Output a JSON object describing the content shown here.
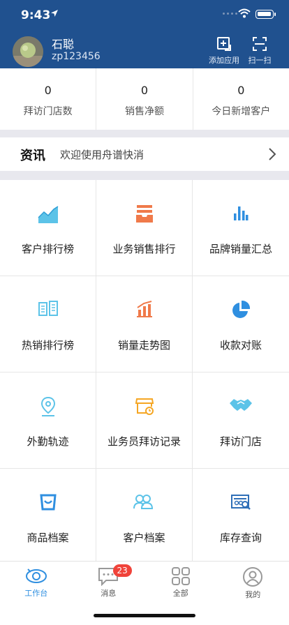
{
  "status": {
    "time": "9:43"
  },
  "user": {
    "name": "石聪",
    "id": "zp123456"
  },
  "header_actions": {
    "add_app": "添加应用",
    "scan": "扫一扫"
  },
  "stats": [
    {
      "value": "0",
      "label": "拜访门店数"
    },
    {
      "value": "0",
      "label": "销售净额"
    },
    {
      "value": "0",
      "label": "今日新增客户"
    }
  ],
  "news": {
    "title": "资讯",
    "text": "欢迎使用舟谱快消"
  },
  "grid": [
    {
      "label": "客户排行榜",
      "icon": "area-chart-icon"
    },
    {
      "label": "业务销售排行",
      "icon": "inbox-list-icon"
    },
    {
      "label": "品牌销量汇总",
      "icon": "bar-chart-icon"
    },
    {
      "label": "热销排行榜",
      "icon": "book-icon"
    },
    {
      "label": "销量走势图",
      "icon": "trend-bar-icon"
    },
    {
      "label": "收款对账",
      "icon": "pie-chart-icon"
    },
    {
      "label": "外勤轨迹",
      "icon": "location-pin-icon"
    },
    {
      "label": "业务员拜访记录",
      "icon": "store-clock-icon"
    },
    {
      "label": "拜访门店",
      "icon": "handshake-icon"
    },
    {
      "label": "商品档案",
      "icon": "bag-icon"
    },
    {
      "label": "客户档案",
      "icon": "people-icon"
    },
    {
      "label": "库存查询",
      "icon": "search-doc-icon"
    }
  ],
  "tabs": [
    {
      "label": "工作台",
      "icon": "workbench-icon",
      "active": true
    },
    {
      "label": "消息",
      "icon": "message-icon",
      "badge": "23"
    },
    {
      "label": "全部",
      "icon": "grid-icon"
    },
    {
      "label": "我的",
      "icon": "person-icon"
    }
  ],
  "colors": {
    "header": "#20518f",
    "accent": "#2f8fe0",
    "badge": "#f0433a",
    "orange": "#f07a4a",
    "light_blue": "#5cc3e8"
  }
}
